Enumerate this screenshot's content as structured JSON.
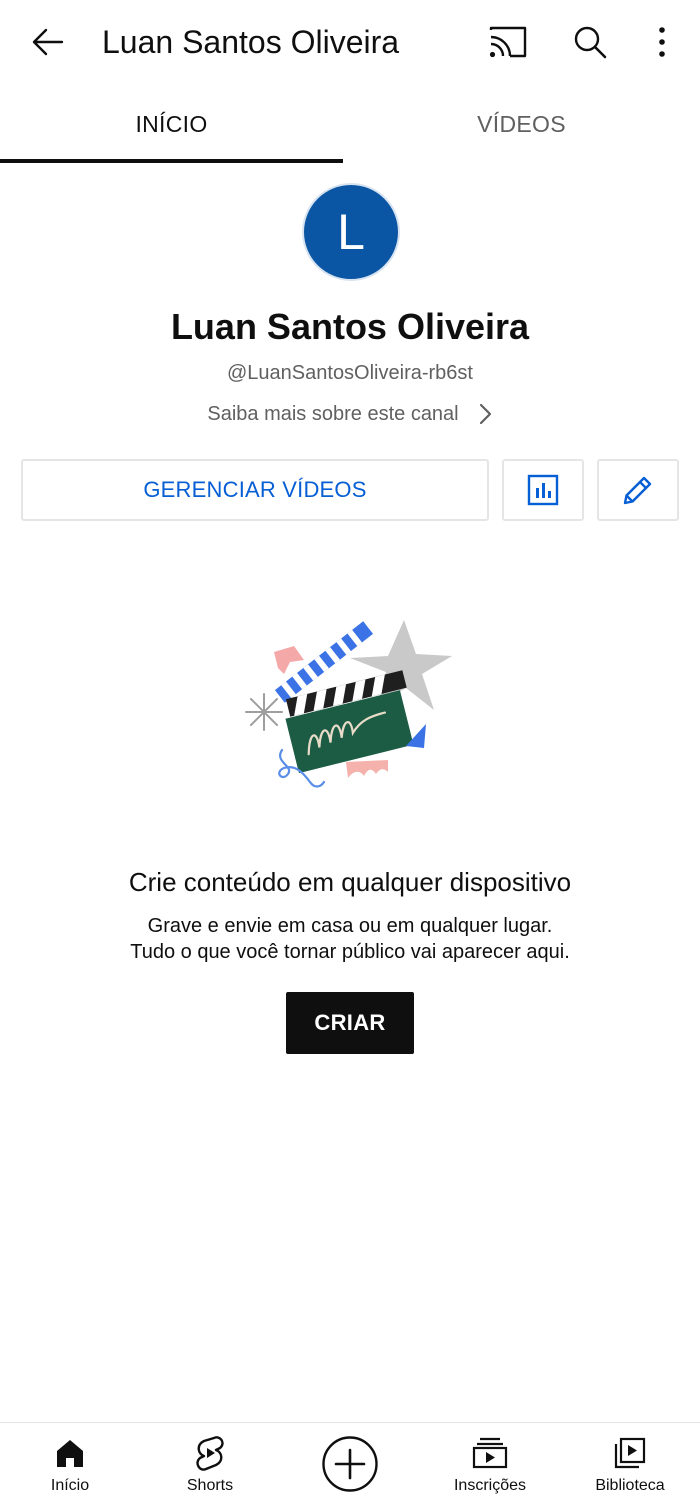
{
  "topbar": {
    "title": "Luan Santos Oliveira",
    "icons": [
      "back-arrow-icon",
      "cast-icon",
      "search-icon",
      "more-vert-icon"
    ]
  },
  "tabs": [
    {
      "label": "INÍCIO",
      "selected": true
    },
    {
      "label": "VÍDEOS",
      "selected": false
    }
  ],
  "channel": {
    "avatar_letter": "L",
    "avatar_color": "#0b56a4",
    "name": "Luan Santos Oliveira",
    "handle": "@LuanSantosOliveira-rb6st",
    "about_link": "Saiba mais sobre este canal"
  },
  "actions": {
    "manage_label": "GERENCIAR VÍDEOS",
    "analytics_icon": "analytics-icon",
    "edit_icon": "pencil-icon"
  },
  "empty_state": {
    "title": "Crie conteúdo em qualquer dispositivo",
    "line1": "Grave e envie em casa ou em qualquer lugar.",
    "line2": "Tudo o que você tornar público vai aparecer aqui.",
    "button": "CRIAR"
  },
  "bottom_nav": [
    {
      "label": "Início",
      "icon": "home-icon",
      "selected": true
    },
    {
      "label": "Shorts",
      "icon": "shorts-icon",
      "selected": false
    },
    {
      "label": "",
      "icon": "create-plus-icon",
      "selected": false
    },
    {
      "label": "Inscrições",
      "icon": "subscriptions-icon",
      "selected": false
    },
    {
      "label": "Biblioteca",
      "icon": "library-icon",
      "selected": false
    }
  ],
  "colors": {
    "accent_blue": "#065fd4",
    "text_primary": "#0f0f0f",
    "text_secondary": "#606060",
    "border": "#e5e5e5"
  }
}
